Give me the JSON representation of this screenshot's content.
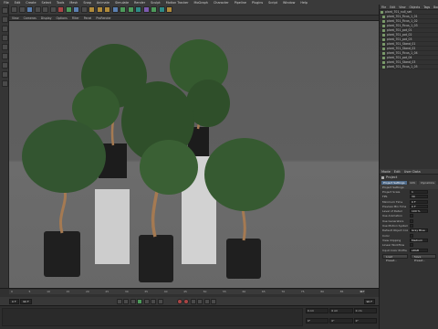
{
  "menubar": {
    "items": [
      "File",
      "Edit",
      "Create",
      "Select",
      "Tools",
      "Mesh",
      "Snap",
      "Animate",
      "Simulate",
      "Render",
      "Sculpt",
      "Motion Tracker",
      "MoGraph",
      "Character",
      "Pipeline",
      "Plugins",
      "Script",
      "Window",
      "Help"
    ]
  },
  "viewport": {
    "tabs": [
      "View",
      "Cameras",
      "Display",
      "Options",
      "Filter",
      "Panel",
      "ProRender"
    ],
    "label": "Perspective"
  },
  "object_manager": {
    "tabs": [
      "File",
      "Edit",
      "View",
      "Objects",
      "Tags",
      "Bookmarks"
    ],
    "root": "plant_701_null_set",
    "items": [
      "plant_701_Ficus_1_01",
      "plant_701_Ficus_1_02",
      "plant_701_Ficus_1_03",
      "plant_701_pot_01",
      "plant_701_pot_02",
      "plant_701_pot_03",
      "plant_701_Stand_01",
      "plant_701_Stand_02",
      "plant_701_Ficus_1_04",
      "plant_701_pot_04",
      "plant_701_Stand_03",
      "plant_701_Ficus_1_05"
    ]
  },
  "attributes": {
    "tabs": [
      "Mode",
      "Edit",
      "User Data"
    ],
    "object_title": "Project",
    "sub_tabs": [
      "Project Settings",
      "Info",
      "Dynamics"
    ],
    "section": "Project Settings",
    "rows": [
      {
        "label": "Project Scale",
        "value": "1"
      },
      {
        "label": "FPS",
        "value": "30"
      },
      {
        "label": "Minimum Time",
        "value": "0 F"
      },
      {
        "label": "Preview Min Time",
        "value": "0 F"
      },
      {
        "label": "Level of Detail",
        "value": "100 %"
      },
      {
        "label": "Use Animation",
        "value": ""
      },
      {
        "label": "Use Generators",
        "value": ""
      },
      {
        "label": "Use Motion System",
        "value": ""
      },
      {
        "label": "Default Object Color",
        "value": "Gray Blue"
      },
      {
        "label": "Color",
        "value": ""
      },
      {
        "label": "View Clipping",
        "value": "Medium"
      },
      {
        "label": "Linear Workflow",
        "value": ""
      },
      {
        "label": "Input Color Profile",
        "value": "sRGB"
      }
    ],
    "buttons": [
      "Load Preset...",
      "Save Preset..."
    ]
  },
  "timeline": {
    "ticks": [
      "0",
      "5",
      "10",
      "15",
      "20",
      "25",
      "30",
      "35",
      "40",
      "45",
      "50",
      "55",
      "60",
      "65",
      "70",
      "75",
      "80",
      "85",
      "90"
    ],
    "frame": "0 F"
  },
  "transport": {
    "start": "0 F",
    "end": "90 F",
    "current": "90 F"
  },
  "coords": {
    "labels": [
      "X",
      "Y",
      "Z",
      "H",
      "P",
      "B"
    ],
    "values": [
      "0 cm",
      "0 cm",
      "0 cm",
      "0°",
      "0°",
      "0°"
    ]
  }
}
